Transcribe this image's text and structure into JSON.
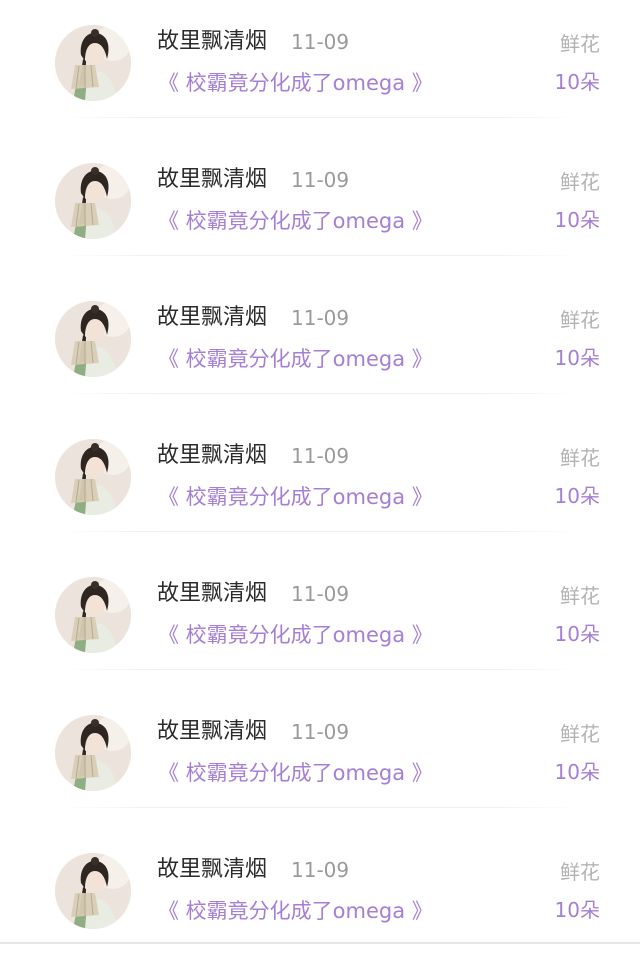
{
  "items": [
    {
      "user": "故里飘清烟",
      "date": "11-09",
      "book": "《 校霸竟分化成了omega 》",
      "gift_label": "鲜花",
      "gift_count": "10朵"
    },
    {
      "user": "故里飘清烟",
      "date": "11-09",
      "book": "《 校霸竟分化成了omega 》",
      "gift_label": "鲜花",
      "gift_count": "10朵"
    },
    {
      "user": "故里飘清烟",
      "date": "11-09",
      "book": "《 校霸竟分化成了omega 》",
      "gift_label": "鲜花",
      "gift_count": "10朵"
    },
    {
      "user": "故里飘清烟",
      "date": "11-09",
      "book": "《 校霸竟分化成了omega 》",
      "gift_label": "鲜花",
      "gift_count": "10朵"
    },
    {
      "user": "故里飘清烟",
      "date": "11-09",
      "book": "《 校霸竟分化成了omega 》",
      "gift_label": "鲜花",
      "gift_count": "10朵"
    },
    {
      "user": "故里飘清烟",
      "date": "11-09",
      "book": "《 校霸竟分化成了omega 》",
      "gift_label": "鲜花",
      "gift_count": "10朵"
    },
    {
      "user": "故里飘清烟",
      "date": "11-09",
      "book": "《 校霸竟分化成了omega 》",
      "gift_label": "鲜花",
      "gift_count": "10朵"
    }
  ],
  "colors": {
    "accent": "#a47fd4",
    "username": "#2b2b2b",
    "date": "#9a9a9a",
    "gift_label": "#b3b3b3"
  }
}
